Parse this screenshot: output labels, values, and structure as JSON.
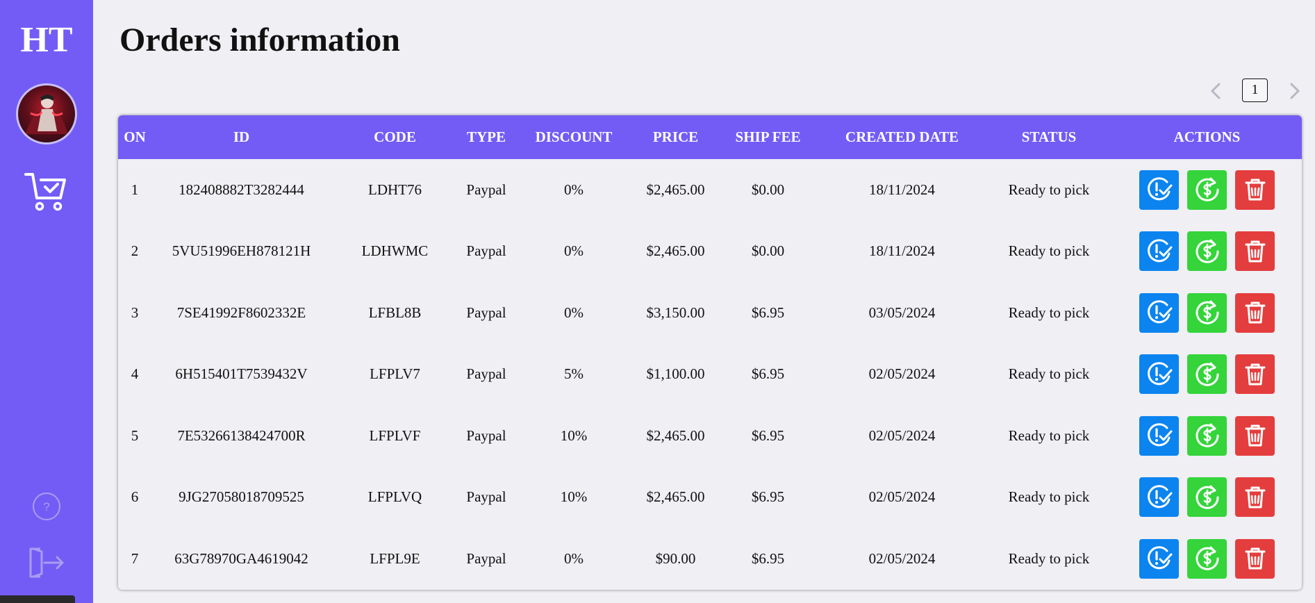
{
  "sidebar": {
    "logo": "HT",
    "nav": [
      {
        "icon": "cart-check-icon"
      },
      {
        "icon": "help-icon"
      },
      {
        "icon": "logout-icon"
      }
    ]
  },
  "page": {
    "title": "Orders information"
  },
  "pagination": {
    "current_page": "1",
    "prev_icon": "chevron-left-icon",
    "next_icon": "chevron-right-icon"
  },
  "table": {
    "columns": [
      "ON",
      "ID",
      "CODE",
      "TYPE",
      "DISCOUNT",
      "PRICE",
      "SHIP FEE",
      "CREATED DATE",
      "STATUS",
      "ACTIONS"
    ],
    "rows": [
      {
        "on": "1",
        "id": "182408882T3282444",
        "code": "LDHT76",
        "type": "Paypal",
        "discount": "0%",
        "price": "$2,465.00",
        "ship_fee": "$0.00",
        "created_date": "18/11/2024",
        "status": "Ready to pick"
      },
      {
        "on": "2",
        "id": "5VU51996EH878121H",
        "code": "LDHWMC",
        "type": "Paypal",
        "discount": "0%",
        "price": "$2,465.00",
        "ship_fee": "$0.00",
        "created_date": "18/11/2024",
        "status": "Ready to pick"
      },
      {
        "on": "3",
        "id": "7SE41992F8602332E",
        "code": "LFBL8B",
        "type": "Paypal",
        "discount": "0%",
        "price": "$3,150.00",
        "ship_fee": "$6.95",
        "created_date": "03/05/2024",
        "status": "Ready to pick"
      },
      {
        "on": "4",
        "id": "6H515401T7539432V",
        "code": "LFPLV7",
        "type": "Paypal",
        "discount": "5%",
        "price": "$1,100.00",
        "ship_fee": "$6.95",
        "created_date": "02/05/2024",
        "status": "Ready to pick"
      },
      {
        "on": "5",
        "id": "7E53266138424700R",
        "code": "LFPLVF",
        "type": "Paypal",
        "discount": "10%",
        "price": "$2,465.00",
        "ship_fee": "$6.95",
        "created_date": "02/05/2024",
        "status": "Ready to pick"
      },
      {
        "on": "6",
        "id": "9JG27058018709525",
        "code": "LFPLVQ",
        "type": "Paypal",
        "discount": "10%",
        "price": "$2,465.00",
        "ship_fee": "$6.95",
        "created_date": "02/05/2024",
        "status": "Ready to pick"
      },
      {
        "on": "7",
        "id": "63G78970GA4619042",
        "code": "LFPL9E",
        "type": "Paypal",
        "discount": "0%",
        "price": "$90.00",
        "ship_fee": "$6.95",
        "created_date": "02/05/2024",
        "status": "Ready to pick"
      }
    ],
    "action_icons": [
      "confirm-check-icon",
      "refund-dollar-icon",
      "trash-icon"
    ]
  },
  "colors": {
    "accent": "#735cf5",
    "background": "#efeff4",
    "confirm": "#0b84ef",
    "refund": "#34d43a",
    "delete": "#e43d3d"
  }
}
